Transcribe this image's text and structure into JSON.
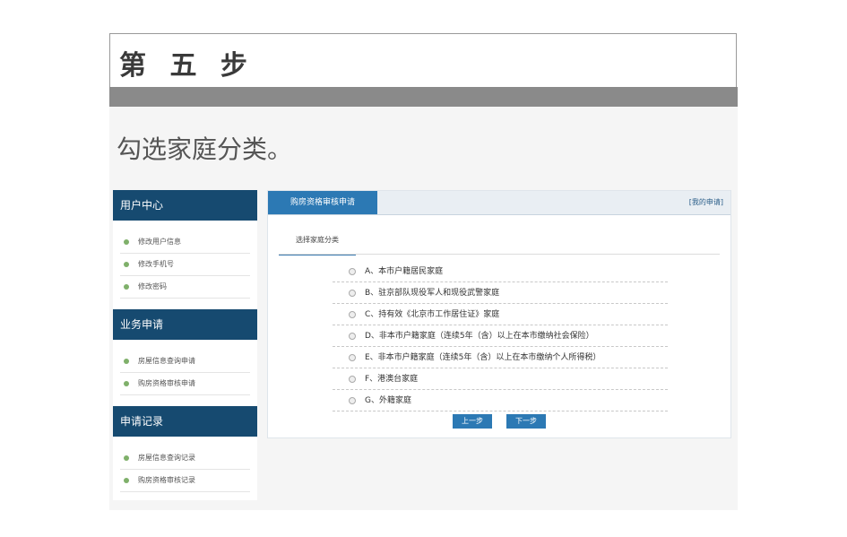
{
  "slide": {
    "title": "第 五 步",
    "instruction": "勾选家庭分类。"
  },
  "sidebar": {
    "sections": [
      {
        "title": "用户中心",
        "items": [
          "修改用户信息",
          "修改手机号",
          "修改密码"
        ]
      },
      {
        "title": "业务申请",
        "items": [
          "房屋信息查询申请",
          "购房资格审核申请"
        ]
      },
      {
        "title": "申请记录",
        "items": [
          "房屋信息查询记录",
          "购房资格审核记录"
        ]
      }
    ]
  },
  "panel": {
    "tab_label": "购房资格审核申请",
    "top_right_link": "[我的申请]",
    "subtab_label": "选择家庭分类",
    "options": [
      "A、本市户籍居民家庭",
      "B、驻京部队现役军人和现役武警家庭",
      "C、持有效《北京市工作居住证》家庭",
      "D、非本市户籍家庭（连续5年（含）以上在本市缴纳社会保险）",
      "E、非本市户籍家庭（连续5年（含）以上在本市缴纳个人所得税）",
      "F、港澳台家庭",
      "G、外籍家庭"
    ],
    "prev_button": "上一步",
    "next_button": "下一步"
  },
  "colors": {
    "sidebar_header": "#164a70",
    "accent_blue": "#2c79b4",
    "title_bar_gray": "#8a8a8a",
    "bullet_green": "#7fb06a"
  }
}
